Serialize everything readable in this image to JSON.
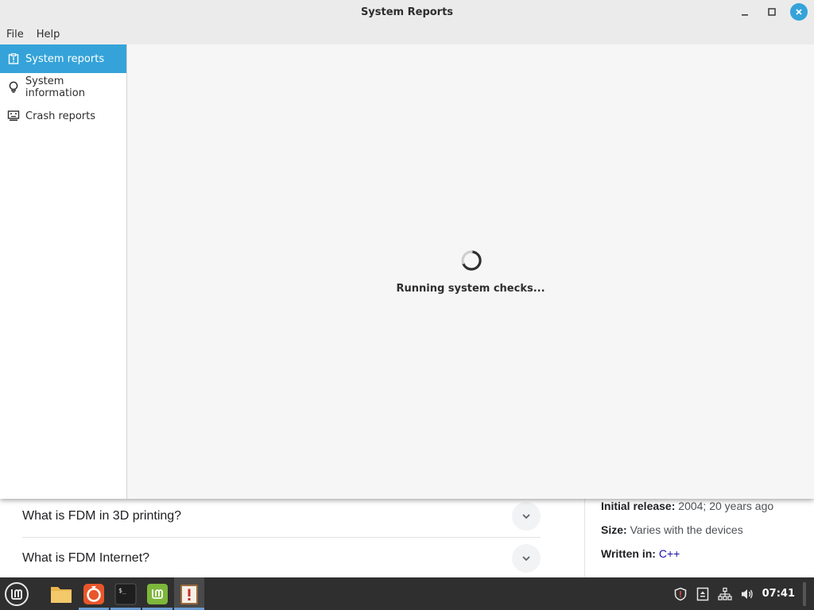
{
  "window": {
    "title": "System Reports"
  },
  "menubar": {
    "items": [
      "File",
      "Help"
    ]
  },
  "sidebar": {
    "items": [
      {
        "label": "System reports",
        "icon": "report-icon",
        "active": true
      },
      {
        "label": "System information",
        "icon": "lightbulb-icon",
        "active": false
      },
      {
        "label": "Crash reports",
        "icon": "crash-monitor-icon",
        "active": false
      }
    ]
  },
  "content": {
    "status": "Running system checks..."
  },
  "background_page": {
    "faq": [
      "What is FDM in 3D printing?",
      "What is FDM Internet?"
    ],
    "info": {
      "initial_release_label": "Initial release:",
      "initial_release_value": "2004; 20 years ago",
      "size_label": "Size:",
      "size_value": "Varies with the devices",
      "written_label": "Written in:",
      "written_value": "C++"
    }
  },
  "taskbar": {
    "apps": [
      "menu-icon",
      "files-icon",
      "firefox-icon",
      "terminal-icon",
      "mintupdate-icon",
      "system-reports-icon"
    ],
    "clock": "07:41"
  },
  "colors": {
    "accent": "#35a3d9",
    "taskbar": "#2f2f2f"
  }
}
